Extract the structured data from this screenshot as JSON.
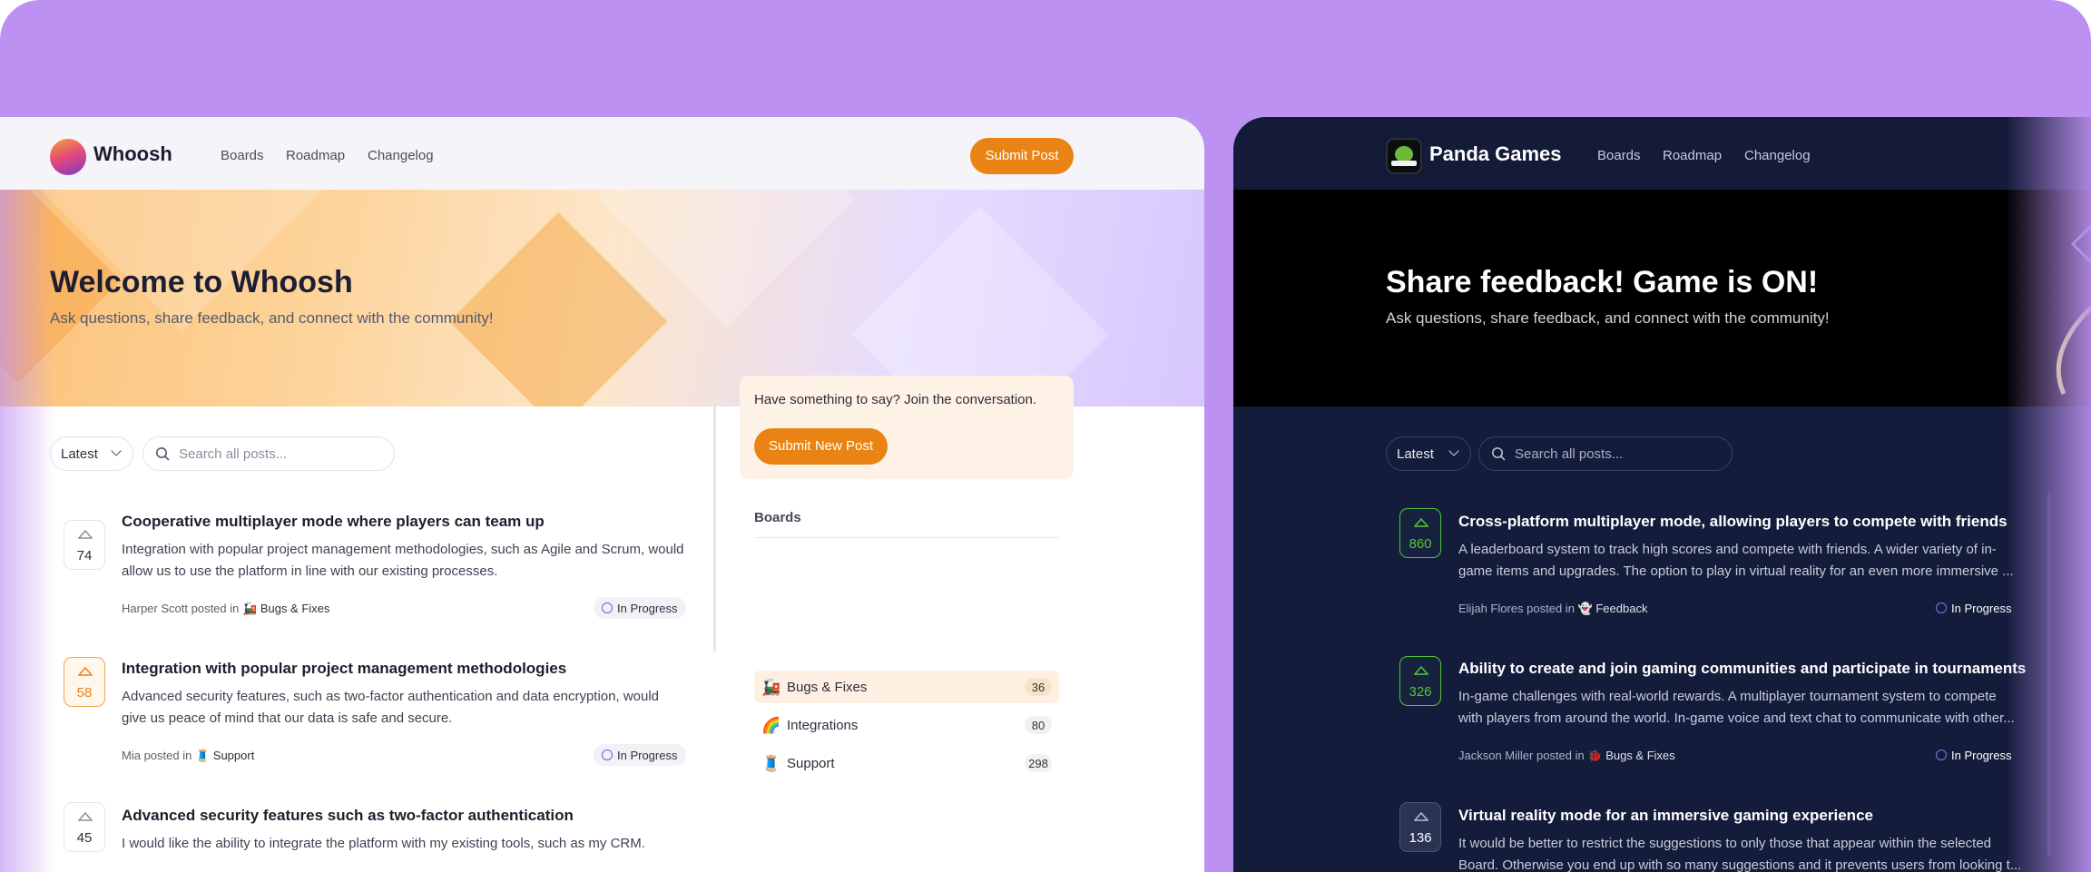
{
  "light": {
    "brand": "Whoosh",
    "nav": [
      "Boards",
      "Roadmap",
      "Changelog"
    ],
    "submit_post": "Submit Post",
    "hero_title": "Welcome to Whoosh",
    "hero_subtitle": "Ask questions, share feedback, and connect with the community!",
    "sort": "Latest",
    "search_placeholder": "Search all posts...",
    "posts": [
      {
        "votes": "74",
        "title": "Cooperative multiplayer mode where players can team up",
        "desc": "Integration with popular project management methodologies, such as Agile and Scrum, would allow us to use the platform in line with our existing processes.",
        "author": "Harper Scott",
        "posted_in": "posted in",
        "board_icon": "🚂",
        "board": "Bugs & Fixes",
        "status": "In Progress"
      },
      {
        "votes": "58",
        "title": "Integration with popular project management methodologies",
        "desc": "Advanced security features, such as two-factor authentication and data encryption, would give us peace of mind that our data is safe and secure.",
        "author": "Mia",
        "posted_in": "posted in",
        "board_icon": "🧵",
        "board": "Support",
        "status": "In Progress"
      },
      {
        "votes": "45",
        "title": "Advanced security features such as two-factor authentication",
        "desc": "I would like the ability to integrate the platform with my existing tools, such as my CRM."
      }
    ],
    "cta_text": "Have something to say? Join the conversation.",
    "cta_button": "Submit New Post",
    "boards_heading": "Boards",
    "boards": [
      {
        "icon": "🚂",
        "name": "Bugs & Fixes",
        "count": "36"
      },
      {
        "icon": "🌈",
        "name": "Integrations",
        "count": "80"
      },
      {
        "icon": "🧵",
        "name": "Support",
        "count": "298"
      }
    ]
  },
  "dark": {
    "brand": "Panda Games",
    "nav": [
      "Boards",
      "Roadmap",
      "Changelog"
    ],
    "hero_title": "Share feedback! Game is ON!",
    "hero_subtitle": "Ask questions, share feedback, and connect with the community!",
    "sort": "Latest",
    "search_placeholder": "Search all posts...",
    "posts": [
      {
        "votes": "860",
        "title": "Cross-platform multiplayer mode, allowing players to compete with friends",
        "desc1": "A leaderboard system to track high scores and compete with friends. A wider variety of in-",
        "desc2": "game items and upgrades. The option to play in virtual reality for an even more immersive ...",
        "author": "Elijah Flores",
        "posted_in": "posted in",
        "board_icon": "👻",
        "board": "Feedback",
        "status": "In Progress"
      },
      {
        "votes": "326",
        "title": "Ability to create and join gaming communities and participate in tournaments",
        "desc1": "In-game challenges with real-world rewards. A multiplayer tournament system to compete",
        "desc2": "with players from around the world. In-game voice and text chat to communicate with other...",
        "author": "Jackson Miller",
        "posted_in": "posted in",
        "board_icon": "🐞",
        "board": "Bugs & Fixes",
        "status": "In Progress"
      },
      {
        "votes": "136",
        "title": "Virtual reality mode for an immersive gaming experience",
        "desc1": "It would be better to restrict the suggestions to only those that appear within the selected",
        "desc2": "Board.  Otherwise you end up with so many suggestions and it prevents users from looking t..."
      }
    ]
  },
  "colors": {
    "frame": "#bd91f1",
    "accent_orange": "#e98414",
    "dark_bg": "#141c3b",
    "dark_vote_green": "#57c43a",
    "status_purple": "#6b5ce6"
  }
}
